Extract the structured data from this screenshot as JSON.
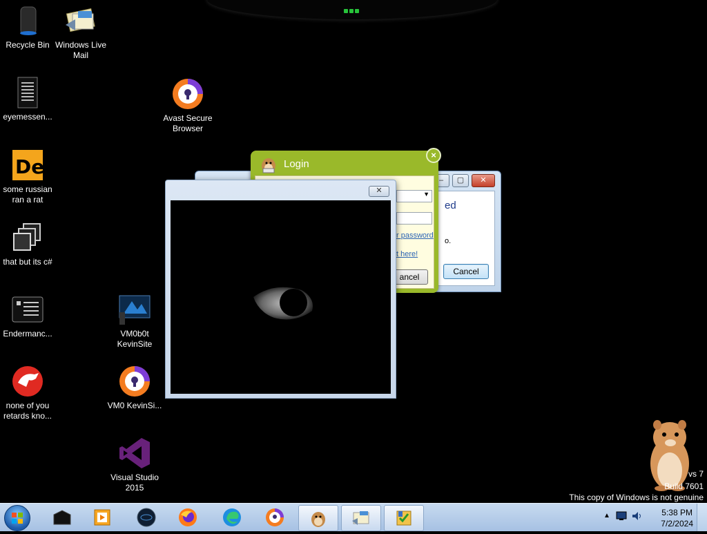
{
  "desktop": {
    "icons": [
      {
        "label": "Recycle Bin",
        "icon": "recycle-bin-icon"
      },
      {
        "label": "Windows Live Mail",
        "icon": "windows-live-mail-icon"
      },
      {
        "label": "eyemessen...",
        "icon": "text-document-icon"
      },
      {
        "label": "Avast Secure Browser",
        "icon": "avast-browser-icon"
      },
      {
        "label": "some russian ran a rat",
        "icon": "de-app-icon"
      },
      {
        "label": "that but its c#",
        "icon": "stacked-windows-icon"
      },
      {
        "label": "Endermanc...",
        "icon": "console-app-icon"
      },
      {
        "label": "VM0b0t KevinSite",
        "icon": "monitor-app-icon"
      },
      {
        "label": "none of you retards kno...",
        "icon": "red-dragon-icon"
      },
      {
        "label": "VM0 KevinSi...",
        "icon": "avast-browser-icon"
      },
      {
        "label": "Visual Studio 2015",
        "icon": "visual-studio-icon"
      }
    ]
  },
  "login_window": {
    "title": "Login",
    "password_link": "r password",
    "register_link": "t here!",
    "cancel_label": "ancel"
  },
  "back_window": {
    "partial_text_1": "ed",
    "partial_text_2": "o.",
    "cancel_label": "Cancel"
  },
  "cam_window": {
    "close_glyph": "✕"
  },
  "watermark": {
    "line1": "vs 7",
    "line2": "Build 7601",
    "line3": "This copy of Windows is not genuine"
  },
  "taskbar": {
    "items": [
      {
        "icon": "black-box-app-icon"
      },
      {
        "icon": "media-player-icon"
      },
      {
        "icon": "dark-globe-app-icon"
      },
      {
        "icon": "firefox-icon"
      },
      {
        "icon": "edge-icon"
      },
      {
        "icon": "avast-browser-icon"
      },
      {
        "icon": "hamster-app-icon"
      },
      {
        "icon": "windows-live-mail-icon"
      },
      {
        "icon": "setup-wizard-icon"
      }
    ],
    "clock_time": "5:38 PM",
    "clock_date": "7/2/2024"
  },
  "colors": {
    "login_green": "#9ab92a",
    "taskbar_blue": "#b3cbe8",
    "desktop_bg": "#000000"
  }
}
